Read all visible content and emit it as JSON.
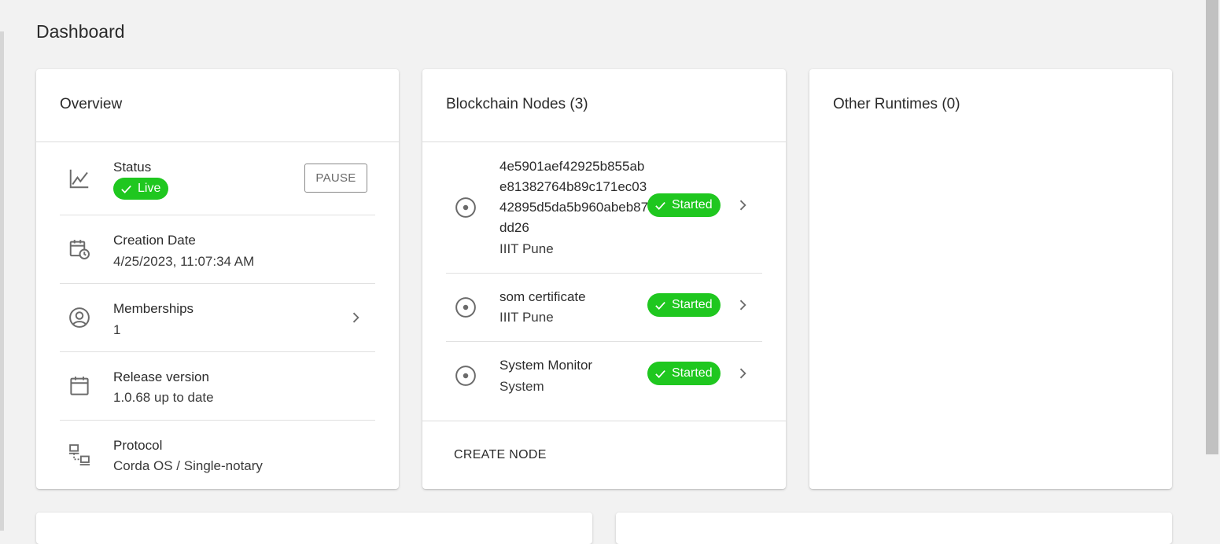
{
  "page": {
    "title": "Dashboard"
  },
  "overview": {
    "title": "Overview",
    "status": {
      "label": "Status",
      "badge": "Live",
      "pause_label": "PAUSE"
    },
    "creation_date": {
      "label": "Creation Date",
      "value": "4/25/2023, 11:07:34 AM"
    },
    "memberships": {
      "label": "Memberships",
      "value": "1"
    },
    "release_version": {
      "label": "Release version",
      "value": "1.0.68 up to date"
    },
    "protocol": {
      "label": "Protocol",
      "value": "Corda OS / Single-notary"
    }
  },
  "nodes": {
    "title": "Blockchain Nodes (3)",
    "items": [
      {
        "name": "4e5901aef42925b855abe81382764b89c171ec0342895d5da5b960abeb87dd26",
        "org": "IIIT Pune",
        "status": "Started"
      },
      {
        "name": "som certificate",
        "org": "IIIT Pune",
        "status": "Started"
      },
      {
        "name": "System Monitor",
        "org": "System",
        "status": "Started"
      }
    ],
    "create_label": "CREATE NODE"
  },
  "runtimes": {
    "title": "Other Runtimes (0)"
  },
  "colors": {
    "live": "#1fc71f",
    "started": "#1fc71f",
    "background": "#f2f2f2"
  },
  "icons": {
    "status": "line-chart-icon",
    "creation_date": "calendar-clock-icon",
    "memberships": "account-circle-icon",
    "release_version": "calendar-icon",
    "protocol": "network-icon",
    "node": "radio-button-icon",
    "chevron": "chevron-right-icon",
    "check": "check-icon"
  }
}
